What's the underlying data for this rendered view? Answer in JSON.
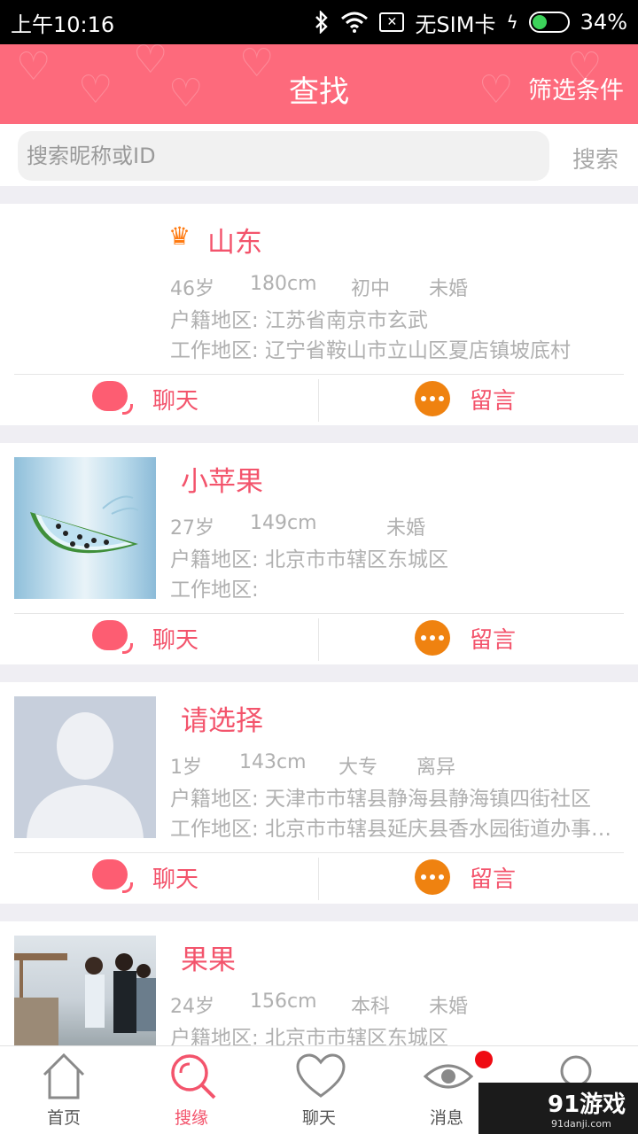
{
  "status_bar": {
    "time": "上午10:16",
    "sim": "无SIM卡",
    "battery": "34%"
  },
  "header": {
    "title": "查找",
    "filter_label": "筛选条件"
  },
  "search": {
    "placeholder": "搜索昵称或ID",
    "button_label": "搜索"
  },
  "users": [
    {
      "name": "山东",
      "age": "46岁",
      "height": "180cm",
      "education": "初中",
      "marital": "未婚",
      "hukou": "户籍地区: 江苏省南京市玄武",
      "work": "工作地区: 辽宁省鞍山市立山区夏店镇坡底村",
      "chat_label": "聊天",
      "message_label": "留言"
    },
    {
      "name": "小苹果",
      "age": "27岁",
      "height": "149cm",
      "education": "",
      "marital": "未婚",
      "hukou": "户籍地区: 北京市市辖区东城区",
      "work": "工作地区:",
      "chat_label": "聊天",
      "message_label": "留言"
    },
    {
      "name": "请选择",
      "age": "1岁",
      "height": "143cm",
      "education": "大专",
      "marital": "离异",
      "hukou": "户籍地区: 天津市市辖县静海县静海镇四街社区",
      "work": "工作地区: 北京市市辖县延庆县香水园街道办事…",
      "chat_label": "聊天",
      "message_label": "留言"
    },
    {
      "name": "果果",
      "age": "24岁",
      "height": "156cm",
      "education": "本科",
      "marital": "未婚",
      "hukou": "户籍地区: 北京市市辖区东城区"
    }
  ],
  "nav": {
    "home": "首页",
    "search": "搜缘",
    "chat": "聊天",
    "messages": "消息"
  },
  "watermark": {
    "brand": "91游戏",
    "url": "91danji.com"
  },
  "colors": {
    "brand": "#fd6a7c",
    "accent_text": "#f3546c",
    "message_icon": "#ef8210"
  }
}
